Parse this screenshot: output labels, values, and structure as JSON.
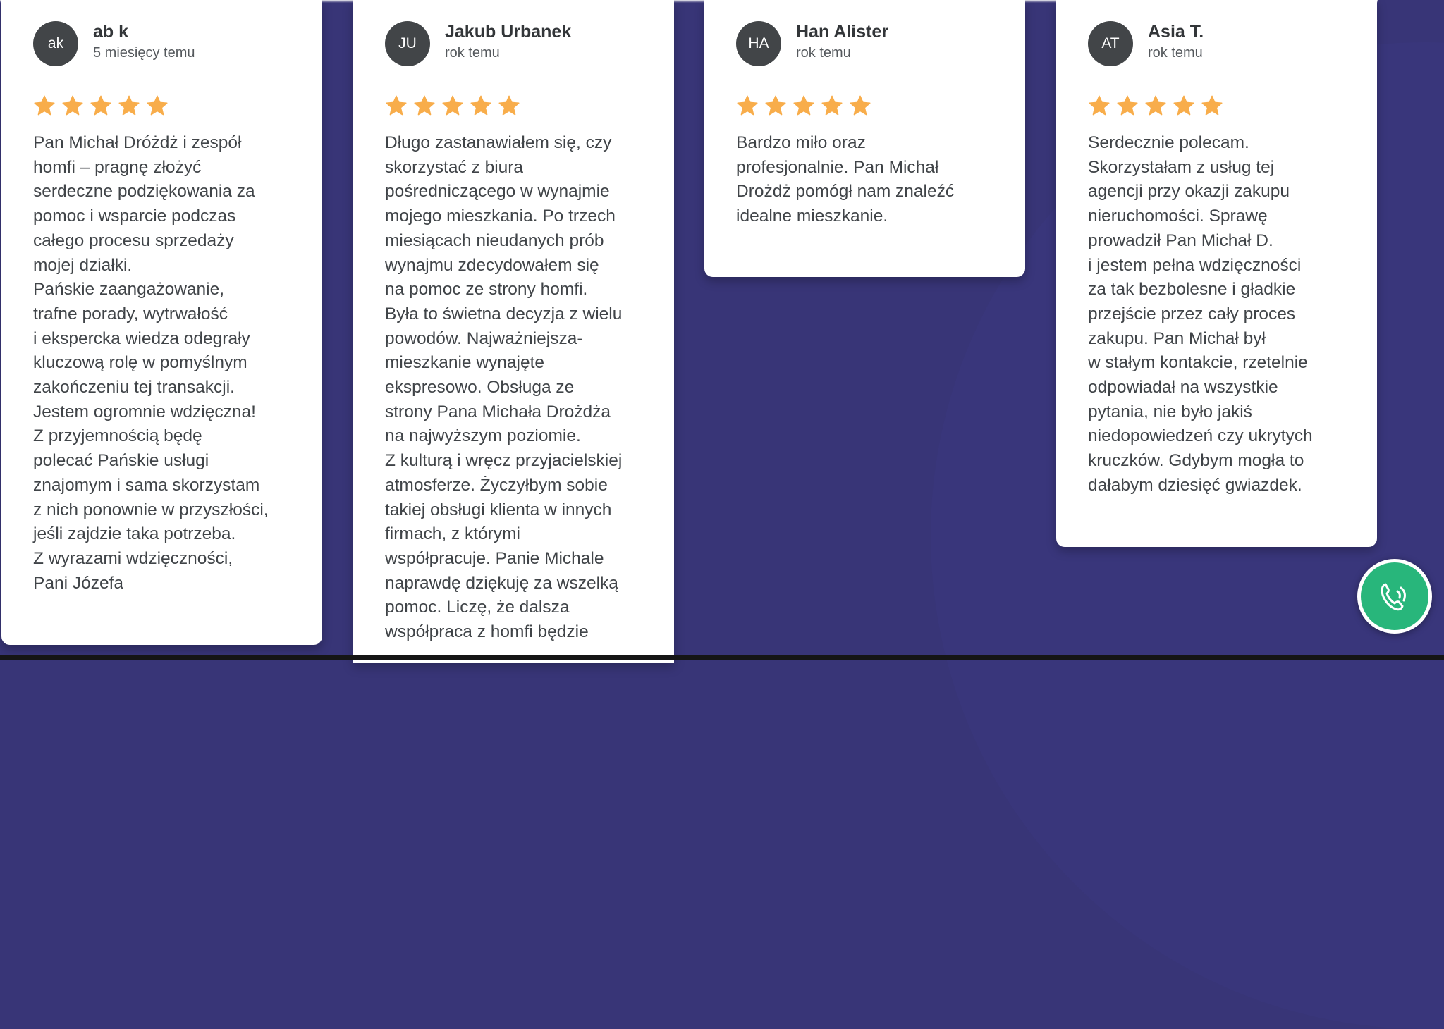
{
  "colors": {
    "background": "#383577",
    "card": "#ffffff",
    "avatar": "#424548",
    "star": "#f8ad4b",
    "call_button": "#28b67b"
  },
  "reviews": [
    {
      "initials": "ak",
      "name": "ab k",
      "time": "5 miesięcy temu",
      "rating": 5,
      "text": "Pan Michał Dróżdż i zespół\nhomfi – pragnę złożyć\nserdeczne podziękowania za\npomoc i wsparcie podczas\ncałego procesu sprzedaży\nmojej działki.\nPańskie zaangażowanie,\ntrafne porady, wytrwałość\ni ekspercka wiedza odegrały\nkluczową rolę w pomyślnym\nzakończeniu tej transakcji.\nJestem ogromnie wdzięczna!\nZ przyjemnością będę\npolecać Pańskie usługi\nznajomym i sama skorzystam\nz nich ponownie w przyszłości,\njeśli zajdzie taka potrzeba.\nZ wyrazami wdzięczności,\nPani Józefa"
    },
    {
      "initials": "JU",
      "name": "Jakub Urbanek",
      "time": "rok temu",
      "rating": 5,
      "text": "Długo zastanawiałem się, czy\nskorzystać z biura\npośredniczącego w wynajmie\nmojego mieszkania. Po trzech\nmiesiącach nieudanych prób\nwynajmu zdecydowałem się\nna pomoc ze strony homfi.\nByła to świetna decyzja z wielu\npowodów. Najważniejsza-\nmieszkanie wynajęte\nekspresowo. Obsługa ze\nstrony Pana Michała Drożdża\nna najwyższym poziomie.\nZ kulturą i wręcz przyjacielskiej\natmosferze. Życzyłbym sobie\ntakiej obsługi klienta w innych\nfirmach, z którymi\nwspółpracuje. Panie Michale\nnaprawdę dziękuję za wszelką\npomoc. Liczę, że dalsza\nwspółpraca z homfi będzie"
    },
    {
      "initials": "HA",
      "name": "Han Alister",
      "time": "rok temu",
      "rating": 5,
      "text": "Bardzo miło oraz\nprofesjonalnie. Pan Michał\nDrożdż pomógł nam znaleźć\nidealne mieszkanie."
    },
    {
      "initials": "AT",
      "name": "Asia T.",
      "time": "rok temu",
      "rating": 5,
      "text": "Serdecznie polecam.\nSkorzystałam z usług tej\nagencji przy okazji zakupu\nnieruchomości. Sprawę\nprowadził Pan Michał D.\ni jestem pełna wdzięczności\nza tak bezbolesne i gładkie\nprzejście przez cały proces\nzakupu. Pan Michał był\nw stałym kontakcie, rzetelnie\nodpowiadał na wszystkie\npytania, nie było jakiś\nniedopowiedzeń czy ukrytych\nkruczków. Gdybym mogła to\ndałabym dziesięć gwiazdek."
    }
  ],
  "call_button": {
    "icon": "phone-call-icon"
  }
}
